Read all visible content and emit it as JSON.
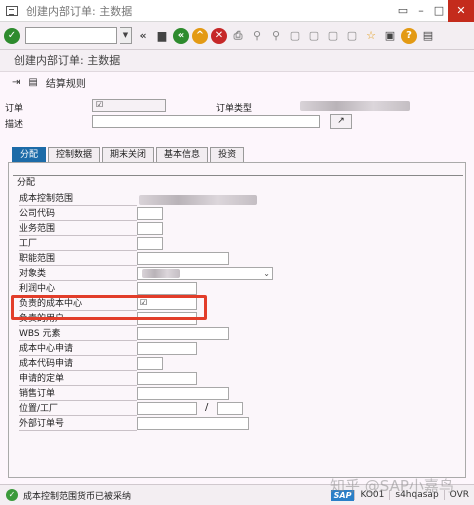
{
  "window": {
    "title": "创建内部订单: 主数据"
  },
  "toolbar": {
    "command_value": ""
  },
  "screen": {
    "title": "创建内部订单: 主数据"
  },
  "apptoolbar": {
    "settlement_rule_label": "结算规则"
  },
  "header": {
    "order_label": "订单",
    "order_value": "☑",
    "order_type_label": "订单类型",
    "description_label": "描述",
    "description_value": ""
  },
  "tabs": [
    {
      "label": "分配",
      "active": true
    },
    {
      "label": "控制数据",
      "active": false
    },
    {
      "label": "期末关闭",
      "active": false
    },
    {
      "label": "基本信息",
      "active": false
    },
    {
      "label": "投资",
      "active": false
    }
  ],
  "assignment": {
    "group_title": "分配",
    "fields": [
      {
        "label": "成本控制范围",
        "value": ""
      },
      {
        "label": "公司代码",
        "value": ""
      },
      {
        "label": "业务范围",
        "value": ""
      },
      {
        "label": "工厂",
        "value": ""
      },
      {
        "label": "职能范围",
        "value": ""
      },
      {
        "label": "对象类",
        "value": ""
      },
      {
        "label": "利润中心",
        "value": ""
      },
      {
        "label": "负责的成本中心",
        "value": "☑"
      },
      {
        "label": "负责的用户",
        "value": ""
      },
      {
        "label": "WBS 元素",
        "value": ""
      },
      {
        "label": "成本中心申请",
        "value": ""
      },
      {
        "label": "成本代码申请",
        "value": ""
      },
      {
        "label": "申请的定单",
        "value": ""
      },
      {
        "label": "销售订单",
        "value": ""
      },
      {
        "label": "位置/工厂",
        "value": "",
        "separator": "/"
      },
      {
        "label": "外部订单号",
        "value": ""
      }
    ]
  },
  "status": {
    "message": "成本控制范围货币已被采纳",
    "sap": "SAP",
    "transaction": "KO01",
    "server": "s4hqasap",
    "mode": "OVR"
  },
  "watermark": "知乎 @SAP小嘉鸟"
}
